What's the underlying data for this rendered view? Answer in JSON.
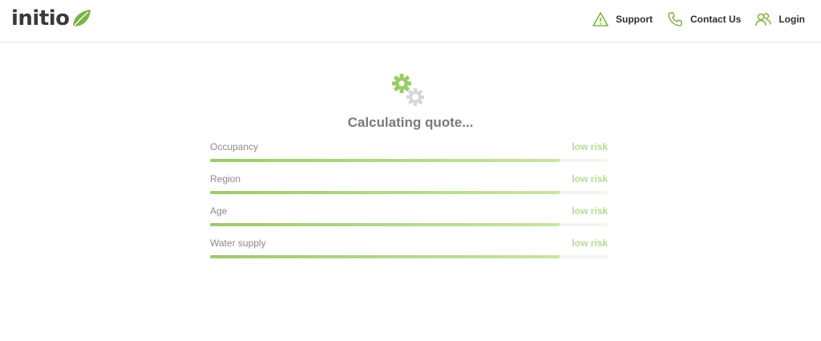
{
  "brand": {
    "name": "initio",
    "accent": "#7cb342"
  },
  "nav": {
    "support_label": "Support",
    "contact_label": "Contact Us",
    "login_label": "Login",
    "support_icon": "warning-triangle-icon",
    "contact_icon": "phone-icon",
    "login_icon": "users-icon"
  },
  "status": {
    "title": "Calculating quote...",
    "icon": "gears-icon"
  },
  "factors": [
    {
      "label": "Occupancy",
      "risk": "low risk",
      "progress": 0.88
    },
    {
      "label": "Region",
      "risk": "low risk",
      "progress": 0.88
    },
    {
      "label": "Age",
      "risk": "low risk",
      "progress": 0.88
    },
    {
      "label": "Water supply",
      "risk": "low risk",
      "progress": 0.88
    }
  ],
  "colors": {
    "risk_text": "#b9d98a",
    "bar_start": "#9ccb6a",
    "bar_end": "#c9e4a6",
    "gear_primary": "#9ccb6a",
    "gear_secondary": "#d6d6d6"
  }
}
